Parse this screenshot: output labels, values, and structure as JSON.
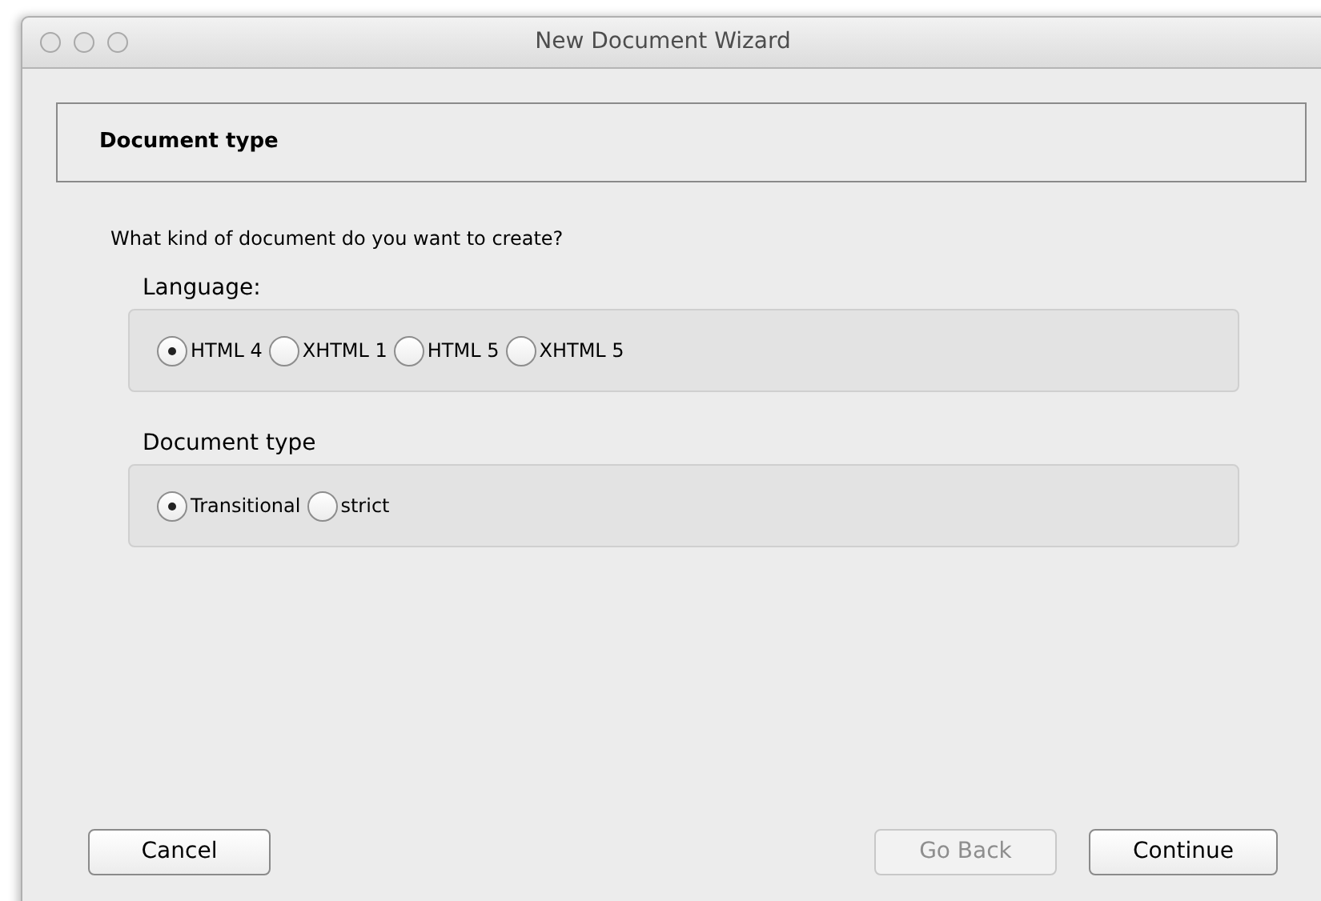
{
  "window": {
    "title": "New Document Wizard"
  },
  "header": {
    "title": "Document type"
  },
  "question": "What kind of document do you want to create?",
  "groups": [
    {
      "label": "Language:",
      "options": [
        {
          "label": "HTML 4",
          "selected": true
        },
        {
          "label": "XHTML 1",
          "selected": false
        },
        {
          "label": "HTML 5",
          "selected": false
        },
        {
          "label": "XHTML 5",
          "selected": false
        }
      ]
    },
    {
      "label": "Document type",
      "options": [
        {
          "label": "Transitional",
          "selected": true
        },
        {
          "label": "strict",
          "selected": false
        }
      ]
    }
  ],
  "buttons": [
    {
      "label": "Cancel",
      "disabled": false
    },
    {
      "label": "Go Back",
      "disabled": true
    },
    {
      "label": "Continue",
      "disabled": false
    }
  ]
}
